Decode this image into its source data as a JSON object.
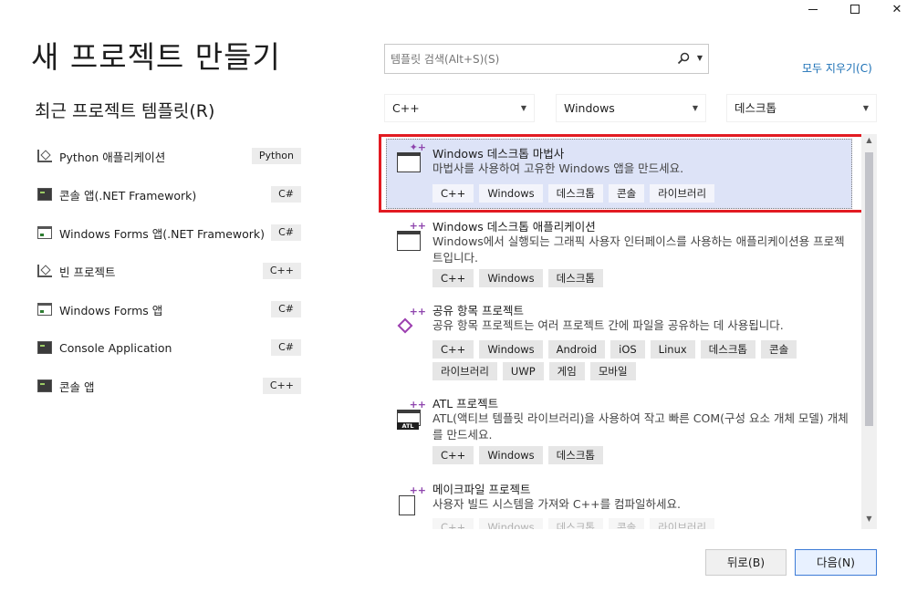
{
  "window": {
    "minimize_symbol": "",
    "close_symbol": "✕"
  },
  "page": {
    "title": "새 프로젝트 만들기",
    "recent_title": "최근 프로젝트 템플릿(R)"
  },
  "recent": [
    {
      "label": "Python 애플리케이션",
      "tag": "Python",
      "icon": "python-app-icon"
    },
    {
      "label": "콘솔 앱(.NET Framework)",
      "tag": "C#",
      "icon": "console-icon"
    },
    {
      "label": "Windows Forms 앱(.NET Framework)",
      "tag": "C#",
      "icon": "window-icon"
    },
    {
      "label": "빈 프로젝트",
      "tag": "C++",
      "icon": "empty-project-icon"
    },
    {
      "label": "Windows Forms 앱",
      "tag": "C#",
      "icon": "window-icon"
    },
    {
      "label": "Console Application",
      "tag": "C#",
      "icon": "console-icon"
    },
    {
      "label": "콘솔 앱",
      "tag": "C++",
      "icon": "console-icon"
    }
  ],
  "search": {
    "placeholder": "템플릿 검색(Alt+S)(S)",
    "clear_all": "모두 지우기(C)"
  },
  "filters": {
    "language": "C++",
    "platform": "Windows",
    "project_type": "데스크톱"
  },
  "templates": [
    {
      "name": "Windows 데스크톱 마법사",
      "description": "마법사를 사용하여 고유한 Windows 앱을 만드세요.",
      "tags": [
        "C++",
        "Windows",
        "데스크톱",
        "콘솔",
        "라이브러리"
      ]
    },
    {
      "name": "Windows 데스크톱 애플리케이션",
      "description": "Windows에서 실행되는 그래픽 사용자 인터페이스를 사용하는 애플리케이션용 프로젝트입니다.",
      "tags": [
        "C++",
        "Windows",
        "데스크톱"
      ]
    },
    {
      "name": "공유 항목 프로젝트",
      "description": "공유 항목 프로젝트는 여러 프로젝트 간에 파일을 공유하는 데 사용됩니다.",
      "tags": [
        "C++",
        "Windows",
        "Android",
        "iOS",
        "Linux",
        "데스크톱",
        "콘솔",
        "라이브러리",
        "UWP",
        "게임",
        "모바일"
      ]
    },
    {
      "name": "ATL 프로젝트",
      "description": "ATL(액티브 템플릿 라이브러리)을 사용하여 작고 빠른 COM(구성 요소 개체 모델) 개체를 만드세요.",
      "tags": [
        "C++",
        "Windows",
        "데스크톱"
      ],
      "icon_text": "ATL"
    },
    {
      "name": "메이크파일 프로젝트",
      "description": "사용자 빌드 시스템을 가져와 C++를 컴파일하세요.",
      "tags": [
        "C++",
        "Windows",
        "데스크톱",
        "콘솔",
        "라이브러리"
      ]
    }
  ],
  "buttons": {
    "back": "뒤로(B)",
    "next": "다음(N)"
  },
  "colors": {
    "selected_bg": "#dde3f7",
    "highlight_border": "#e21b22",
    "link": "#1a6fb5"
  }
}
